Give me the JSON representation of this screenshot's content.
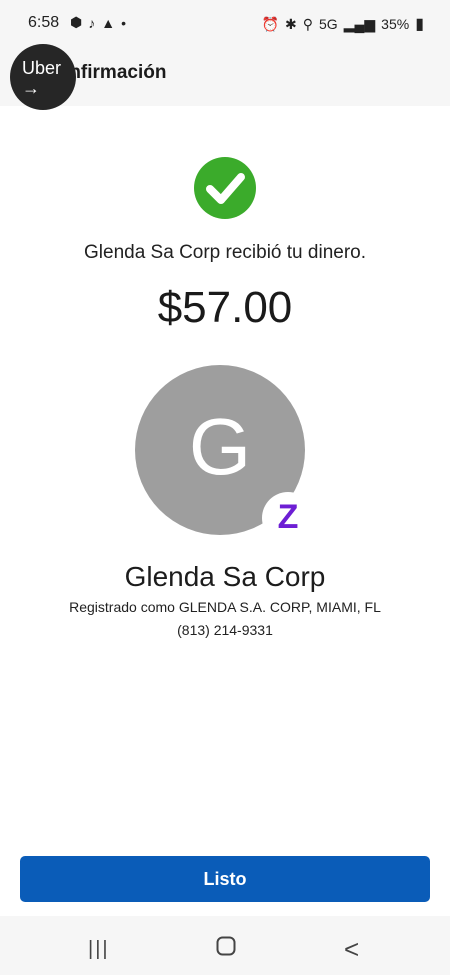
{
  "status_bar": {
    "time": "6:58",
    "battery": "35%",
    "network": "5G"
  },
  "header": {
    "title": "Confirmación"
  },
  "overlay": {
    "uber_label": "Uber",
    "arrow": "→"
  },
  "confirmation": {
    "message": "Glenda Sa Corp recibió tu dinero.",
    "amount": "$57.00",
    "success_color": "#3bab2b"
  },
  "recipient": {
    "initial": "G",
    "name": "Glenda Sa Corp",
    "registered_as": "Registrado como GLENDA S.A. CORP, MIAMI, FL",
    "phone": "(813) 214-9331",
    "badge_letter": "Z",
    "badge_color": "#6d1ed4"
  },
  "actions": {
    "done_label": "Listo",
    "button_color": "#0a5cb8"
  },
  "nav": {
    "recents": "|||",
    "back": "<"
  }
}
